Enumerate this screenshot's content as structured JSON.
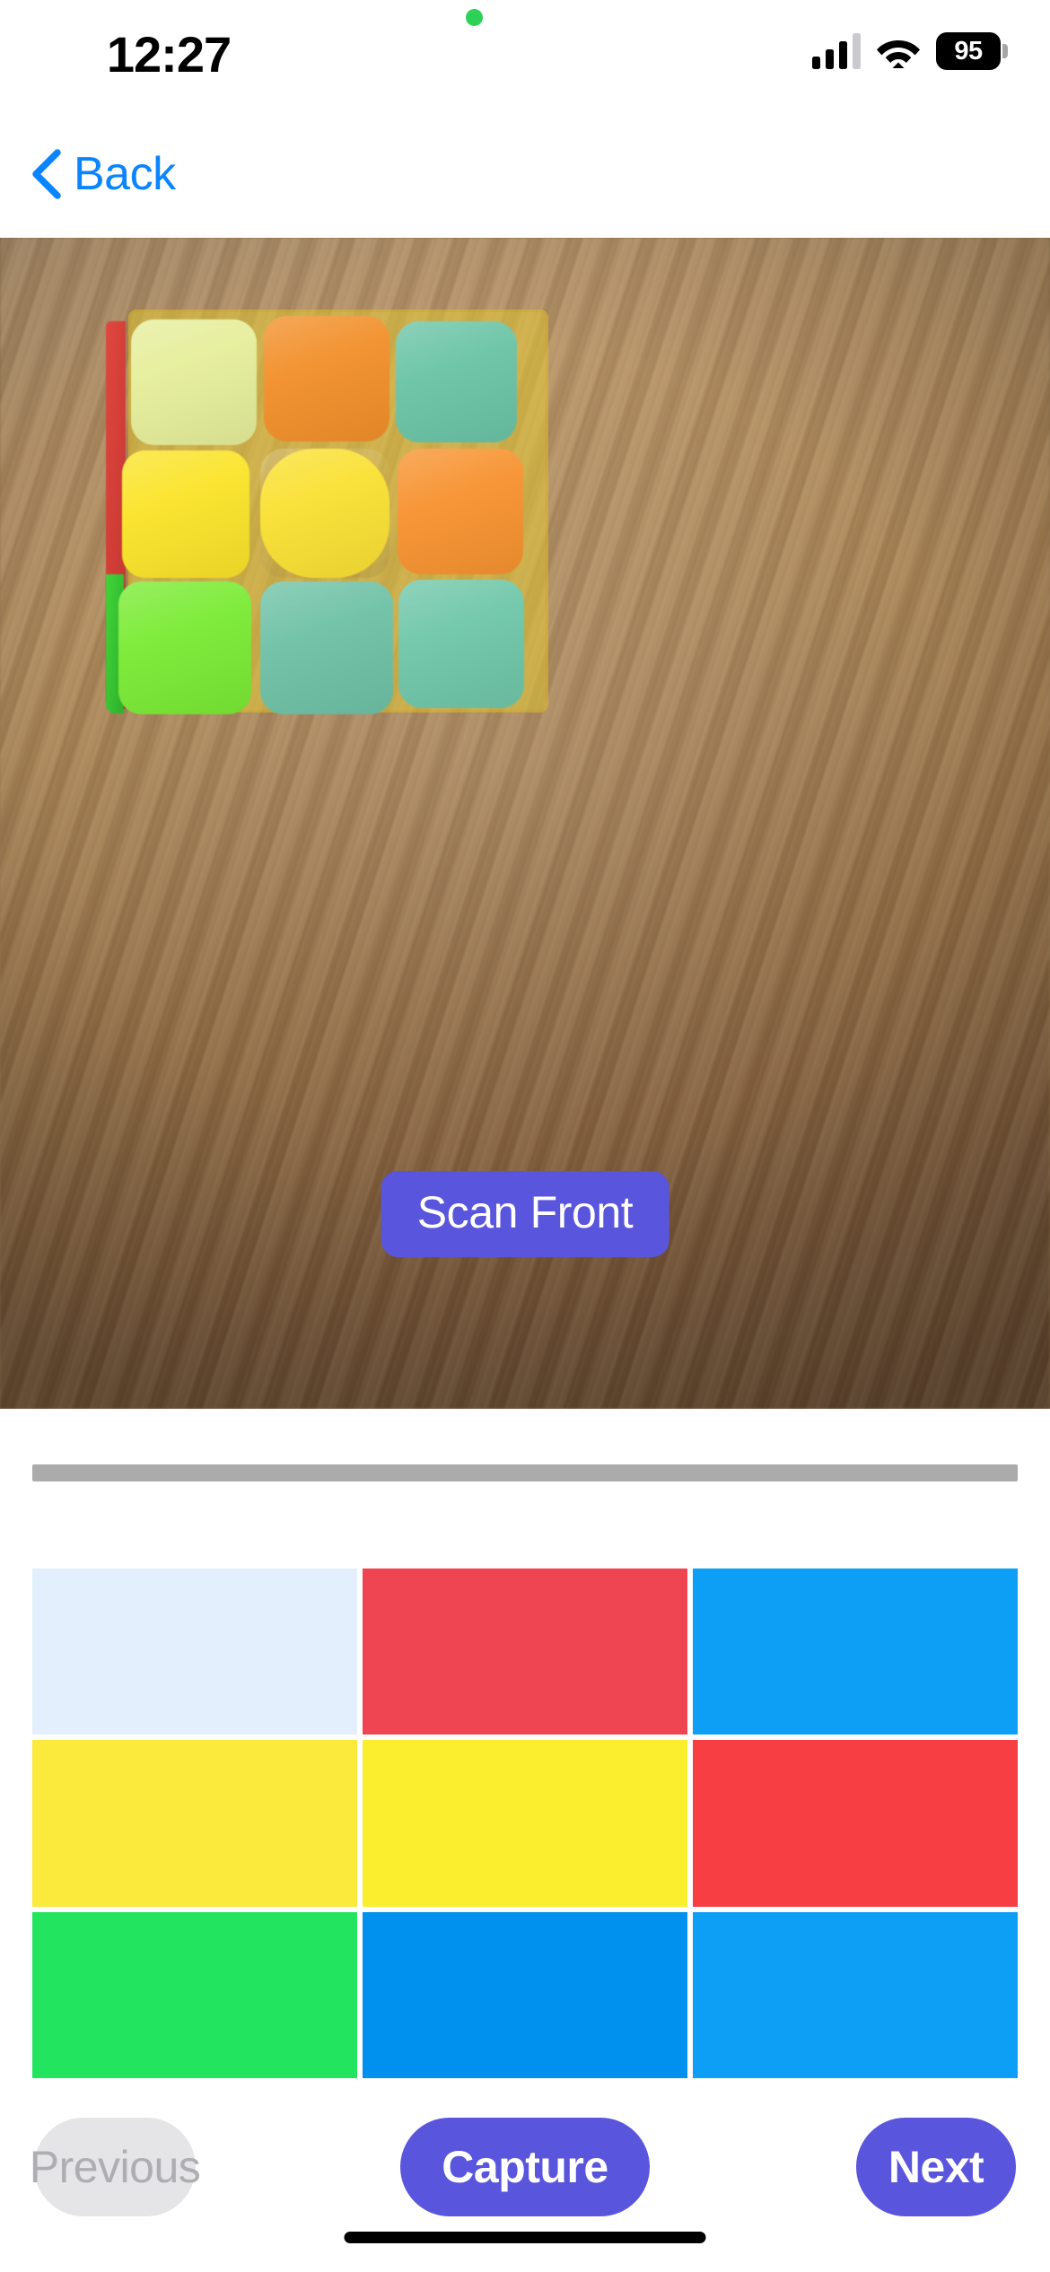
{
  "status_bar": {
    "time": "12:27",
    "battery_level": "95",
    "icons": [
      "green-recording-dot",
      "cellular-signal-icon",
      "wifi-icon",
      "battery-icon"
    ]
  },
  "nav": {
    "back_label": "Back",
    "back_icon": "chevron-left-icon",
    "accent_color": "#0A84FF"
  },
  "camera": {
    "scan_badge_label": "Scan Front",
    "badge_color": "#5A55DD",
    "guide_overlay_color": "#E9CE2E",
    "detected_stickers": [
      {
        "pos": "top-left",
        "color": "#E6EE9B"
      },
      {
        "pos": "top-center",
        "color": "#F2902B"
      },
      {
        "pos": "top-right",
        "color": "#6BC4A6"
      },
      {
        "pos": "middle-left",
        "color": "#FBE42A"
      },
      {
        "pos": "middle-center",
        "color": "#FAE134"
      },
      {
        "pos": "middle-right",
        "color": "#F79331"
      },
      {
        "pos": "bottom-left",
        "color": "#7BEB35"
      },
      {
        "pos": "bottom-center",
        "color": "#6FC2A6"
      },
      {
        "pos": "bottom-right",
        "color": "#70C7AA"
      }
    ]
  },
  "sheet": {
    "grabber": "sheet-grabber-handle",
    "grid_title": "scanned-face-colors",
    "grid": [
      {
        "index": 0,
        "color": "#E3EFFC",
        "name": "white"
      },
      {
        "index": 1,
        "color": "#EF4553",
        "name": "red"
      },
      {
        "index": 2,
        "color": "#0D9FF5",
        "name": "blue"
      },
      {
        "index": 3,
        "color": "#FBE93C",
        "name": "yellow"
      },
      {
        "index": 4,
        "color": "#FBEE2F",
        "name": "yellow"
      },
      {
        "index": 5,
        "color": "#F73E43",
        "name": "red"
      },
      {
        "index": 6,
        "color": "#22E45F",
        "name": "green"
      },
      {
        "index": 7,
        "color": "#0090EE",
        "name": "blue"
      },
      {
        "index": 8,
        "color": "#0D9FF5",
        "name": "blue"
      }
    ],
    "buttons": {
      "previous_label": "Previous",
      "previous_disabled": true,
      "capture_label": "Capture",
      "next_label": "Next",
      "primary_color": "#5A55DD",
      "disabled_bg": "#E5E5E7",
      "disabled_fg": "#AEAEB2"
    }
  }
}
